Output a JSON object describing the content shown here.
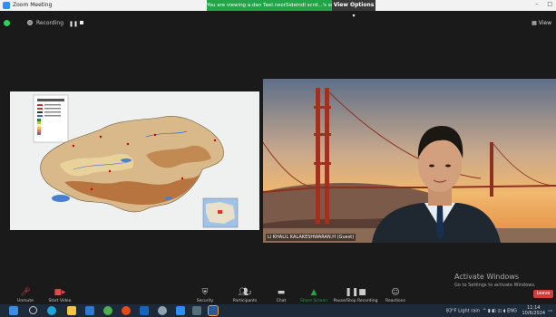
{
  "window": {
    "title": "Zoom Meeting"
  },
  "share_banner": {
    "text": "You are viewing a.dan Tael.neorSideindl scrd...'s screen"
  },
  "view_options": {
    "label": "View Options ▾"
  },
  "recording": {
    "label": "Recording"
  },
  "view_button": {
    "label": "▦ View"
  },
  "participant": {
    "name": "Li KHALIL KALAKESHWARAN.H (Guest)"
  },
  "activate": {
    "line1": "Activate Windows",
    "line2": "Go to Settings to activate Windows."
  },
  "toolbar": {
    "items": [
      {
        "label": "Unmute",
        "icon": "microphone-icon"
      },
      {
        "label": "Start Video",
        "icon": "video-camera-icon"
      },
      {
        "label": "Security",
        "icon": "shield-icon"
      },
      {
        "label": "Participants",
        "icon": "participants-icon"
      },
      {
        "label": "Chat",
        "icon": "chat-icon"
      },
      {
        "label": "Share Screen",
        "icon": "share-screen-icon"
      },
      {
        "label": "Pause/Stop Recording",
        "icon": "recording-icon"
      },
      {
        "label": "Reactions",
        "icon": "reactions-icon"
      }
    ],
    "participants_count": "2",
    "leave": "Leave"
  },
  "taskbar": {
    "weather": "83°F Light rain",
    "lang": "ENG",
    "time": "11:14",
    "date": "10/6/2024",
    "icons": [
      "start-icon",
      "search-icon",
      "edge-icon",
      "file-explorer-icon",
      "mail-icon",
      "chrome-icon",
      "app-icon",
      "app-icon",
      "app-icon",
      "app-icon",
      "word-icon",
      "zoom-icon"
    ]
  },
  "colors": {
    "share_green": "#21a548",
    "leave_red": "#d63b3b",
    "taskbar": "#1c2a3a"
  }
}
